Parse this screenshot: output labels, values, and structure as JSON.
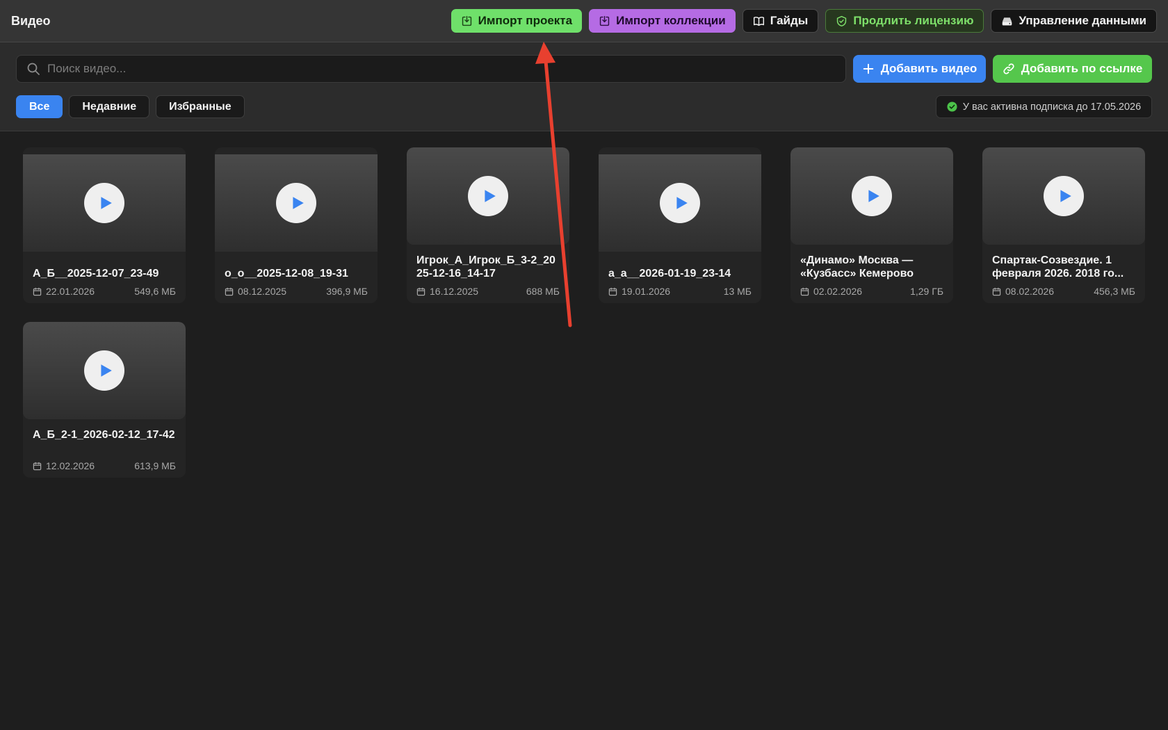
{
  "header": {
    "title": "Видео",
    "buttons": {
      "import_project": "Импорт проекта",
      "import_collection": "Импорт коллекции",
      "guides": "Гайды",
      "extend_license": "Продлить лицензию",
      "data_management": "Управление данными"
    }
  },
  "toolbar": {
    "search_placeholder": "Поиск видео...",
    "add_video": "Добавить видео",
    "add_by_link": "Добавить по ссылке",
    "filters": [
      "Все",
      "Недавние",
      "Избранные"
    ],
    "active_filter": "Все",
    "subscription": "У вас активна подписка до 17.05.2026"
  },
  "videos": [
    {
      "title": "А_Б__2025-12-07_23-49",
      "date": "22.01.2026",
      "size": "549,6 МБ"
    },
    {
      "title": "о_о__2025-12-08_19-31",
      "date": "08.12.2025",
      "size": "396,9 МБ"
    },
    {
      "title": "Игрок_А_Игрок_Б_3-2_2025-12-16_14-17",
      "date": "16.12.2025",
      "size": "688 МБ"
    },
    {
      "title": "а_а__2026-01-19_23-14",
      "date": "19.01.2026",
      "size": "13 МБ"
    },
    {
      "title": "«Динамо» Москва — «Кузбасс» Кемерово",
      "date": "02.02.2026",
      "size": "1,29 ГБ"
    },
    {
      "title": "Спартак-Созвездие. 1 февраля  2026. 2018 го...",
      "date": "08.02.2026",
      "size": "456,3 МБ"
    },
    {
      "title": "А_Б_2-1_2026-02-12_17-42",
      "date": "12.02.2026",
      "size": "613,9 МБ"
    }
  ],
  "colors": {
    "accent_blue": "#3a84f0",
    "accent_green": "#55c74c",
    "import_project_green": "#6fe06a",
    "import_collection_purple": "#b56be4",
    "annotation_red": "#e8402f"
  }
}
